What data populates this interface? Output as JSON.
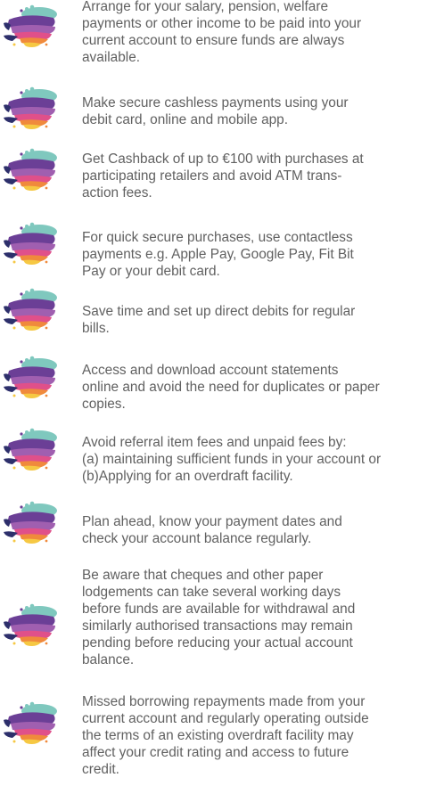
{
  "tips": [
    {
      "icon": "colorful-layered-blob-icon",
      "text": "Arrange for your  salary, pension, welfare\npayments or other income to be paid into your\ncurrent account to ensure funds are always\navailable."
    },
    {
      "icon": "colorful-layered-blob-icon",
      "text": "Make secure cashless payments using your\ndebit card, online and mobile app."
    },
    {
      "icon": "colorful-layered-blob-icon",
      "text": "Get Cashback of up to €100 with purchases at\nparticipating retailers and avoid ATM trans-\naction fees."
    },
    {
      "icon": "colorful-layered-blob-icon",
      "text": "For quick secure purchases, use contactless\npayments e.g. Apple Pay, Google Pay, Fit Bit\nPay or your debit card."
    },
    {
      "icon": "colorful-layered-blob-icon",
      "text": "Save time and set up direct debits for regular\nbills."
    },
    {
      "icon": "colorful-layered-blob-icon",
      "text": "Access and download account statements\nonline and avoid the need for duplicates or paper\ncopies."
    },
    {
      "icon": "colorful-layered-blob-icon",
      "text": "Avoid referral item fees and unpaid fees by:\n(a) maintaining sufficient funds in your account or\n(b)Applying for an overdraft facility."
    },
    {
      "icon": "colorful-layered-blob-icon",
      "text": "Plan ahead, know your payment dates and\ncheck your account balance regularly."
    },
    {
      "icon": "colorful-layered-blob-icon",
      "text": "Be aware that cheques and other paper\nlodgements can take several working days\nbefore funds are available for withdrawal and\nsimilarly authorised transactions may remain\npending before reducing your actual account\nbalance."
    },
    {
      "icon": "colorful-layered-blob-icon",
      "text": "Missed borrowing repayments made from your\ncurrent account and regularly operating outside\nthe terms of an existing overdraft facility may\naffect your credit rating and access to future\ncredit."
    }
  ],
  "colors": {
    "text": "#616161",
    "icon_teal": "#7fc8be",
    "icon_purple": "#6b3f96",
    "icon_pink": "#e0508a",
    "icon_orange": "#f08a3c",
    "icon_yellow": "#f6c843",
    "icon_navy": "#2d2f6b"
  }
}
